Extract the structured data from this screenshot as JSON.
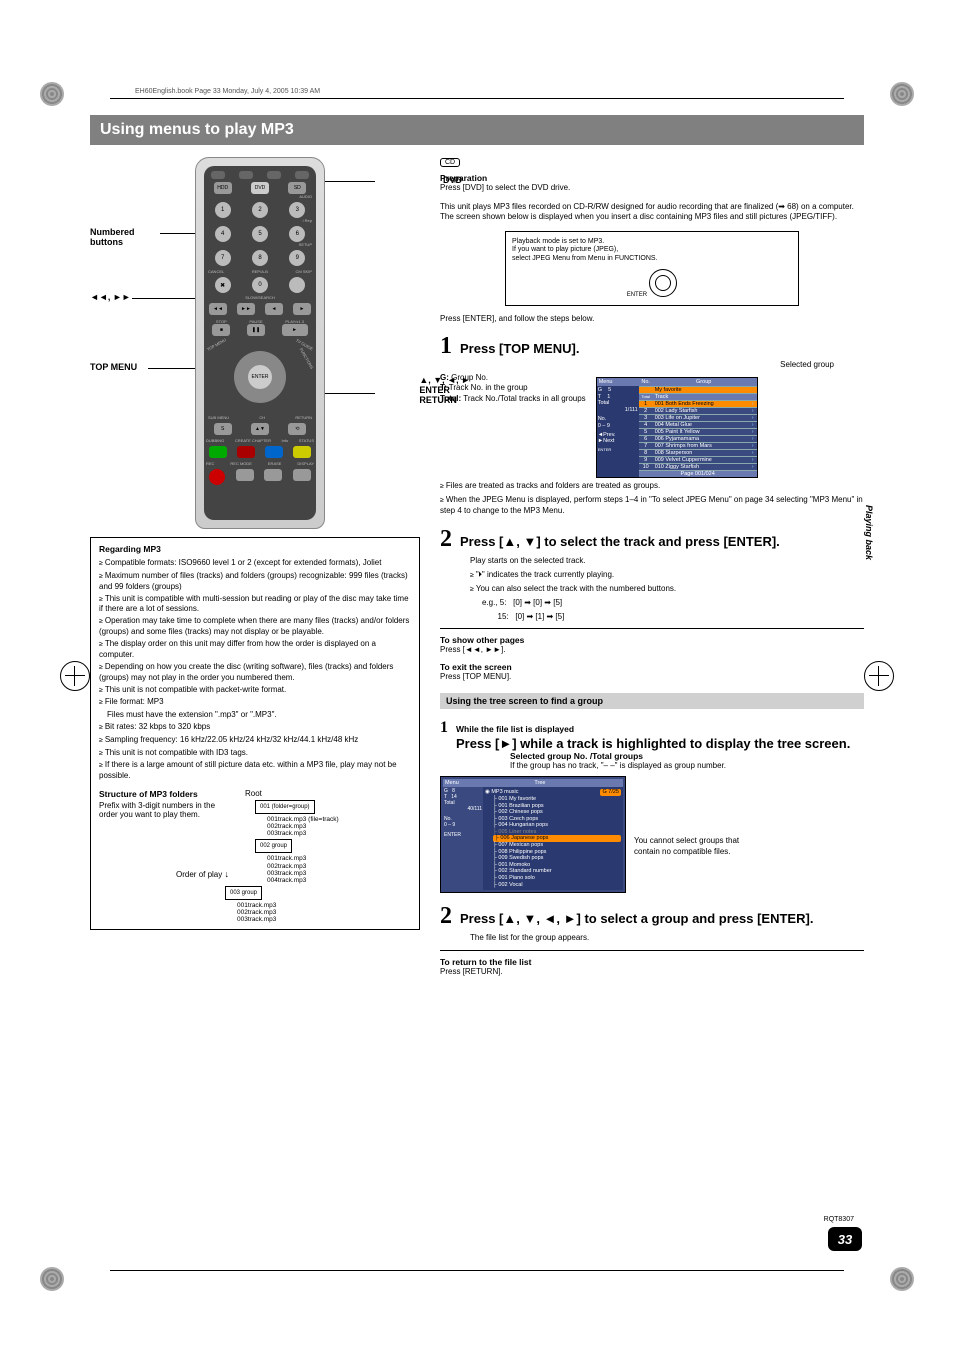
{
  "bookinfo": "EH60English.book  Page 33  Monday, July 4, 2005  10:39 AM",
  "title": "Using menus to play MP3",
  "remote_labels": {
    "numbered": "Numbered buttons",
    "skip": "◄◄, ►►",
    "topmenu": "TOP MENU",
    "dvd": "DVD",
    "arrows": "▲, ▼, ◄, ►\nENTER\nRETURN"
  },
  "remote_btns": {
    "hdd": "HDD",
    "dvd": "DVD",
    "sd": "SD",
    "audio": "AUDIO",
    "irep": "i Rep",
    "setup": "SETUP",
    "cancel": "CANCEL",
    "rep": "REP/A-B",
    "cmskip": "CM SKIP",
    "slow": "SLOW/SEARCH",
    "stop": "STOP",
    "pause": "PAUSE",
    "play": "PLAY/x1.3",
    "submenu": "SUB MENU",
    "return": "RETURN",
    "ch": "CH",
    "dubbing": "DUBBING",
    "create": "CREATE CHAPTER",
    "info": "Info",
    "status": "STATUS",
    "rec": "REC",
    "recmode": "REC MODE",
    "erase": "ERASE",
    "display": "DISPLAY",
    "s": "S",
    "enter": "ENTER",
    "tvguide": "TV GUIDE",
    "functions": "FUNCTIONS"
  },
  "mp3": {
    "h": "Regarding MP3",
    "p1": "Compatible formats: ISO9660 level 1 or 2 (except for extended formats), Joliet",
    "p2": "Maximum number of files (tracks) and folders (groups) recognizable: 999 files (tracks) and 99 folders (groups)",
    "p3": "This unit is compatible with multi-session but reading or play of the disc may take time if there are a lot of sessions.",
    "p4": "Operation may take time to complete when there are many files (tracks) and/or folders (groups) and some files (tracks) may not display or be playable.",
    "p5": "The display order on this unit may differ from how the order is displayed on a computer.",
    "p6": "Depending on how you create the disc (writing software), files (tracks) and folders (groups) may not play in the order you numbered them.",
    "p7": "This unit is not compatible with packet-write format.",
    "p8": "File format: MP3",
    "p8b": "Files must have the extension \".mp3\" or \".MP3\".",
    "p9": "Bit rates: 32 kbps to 320 kbps",
    "p10": "Sampling frequency: 16 kHz/22.05 kHz/24 kHz/32 kHz/44.1 kHz/48 kHz",
    "p11": "This unit is not compatible with ID3 tags.",
    "p12": "If there is a large amount of still picture data etc. within a MP3 file, play may not be possible.",
    "struct_h": "Structure of MP3 folders",
    "struct_p": "Prefix with 3-digit numbers in the order you want to play them.",
    "order": "Order of play",
    "root": "Root",
    "g1": "001 (folder=group)",
    "g1f": "001track.mp3 (file=track)\n002track.mp3\n003track.mp3",
    "g2": "002 group",
    "g2f": "001track.mp3\n002track.mp3\n003track.mp3\n004track.mp3",
    "g3": "003 group",
    "g3f": "001track.mp3\n002track.mp3\n003track.mp3"
  },
  "cd": "CD",
  "prep": {
    "h": "Preparation",
    "l1": "Press [DVD] to select the DVD drive.",
    "l2": "This unit plays MP3 files recorded on CD-R/RW designed for audio recording that are finalized (➡ 68) on a computer.",
    "l3": "The screen shown below is displayed when you insert a disc containing MP3 files and still pictures (JPEG/TIFF).",
    "pb1": "Playback mode is set to MP3.",
    "pb2": "If you want to play picture (JPEG),",
    "pb3": "select JPEG Menu from Menu in FUNCTIONS.",
    "enter": "ENTER",
    "l4": "Press [ENTER], and follow the steps below."
  },
  "step1": {
    "n": "1",
    "t": "Press [TOP MENU].",
    "selgrp": "Selected group",
    "g": "G:",
    "gv": "Group No.",
    "tk": "T:",
    "tkv": "Track No. in the group",
    "tot": "Total:",
    "totv": "Track No./Total tracks in all groups",
    "n1": "Files are treated as tracks and folders are treated as groups.",
    "n2": "When the JPEG Menu is displayed, perform steps 1–4 in \"To select JPEG Menu\" on page 34 selecting \"MP3 Menu\" in step 4 to change to the MP3 Menu."
  },
  "menu1": {
    "menu": "Menu",
    "no": "No.",
    "group": "Group",
    "g": "G",
    "t": "T",
    "total": "Total",
    "gv": "5",
    "tv": "1",
    "totv": "1/111",
    "nolbl": "No.",
    "digits": "0 – 9",
    "prev": "Prev.",
    "next": "Next",
    "enter": "ENTER",
    "totallbl": "Total",
    "tracklbl": "Track",
    "gname": "My favorite",
    "rows": [
      {
        "n": "1",
        "t": "001 Both Ends Freezing"
      },
      {
        "n": "2",
        "t": "002 Lady Starfish"
      },
      {
        "n": "3",
        "t": "003 Life on Jupiter"
      },
      {
        "n": "4",
        "t": "004 Metal Glue"
      },
      {
        "n": "5",
        "t": "005 Paint It Yellow"
      },
      {
        "n": "6",
        "t": "006 Pyjamamama"
      },
      {
        "n": "7",
        "t": "007 Shrimps from Mars"
      },
      {
        "n": "8",
        "t": "008 Starperson"
      },
      {
        "n": "9",
        "t": "009 Velvet Cuppermine"
      },
      {
        "n": "10",
        "t": "010 Ziggy Starfish"
      }
    ],
    "page": "Page 001/024"
  },
  "step2": {
    "n": "2",
    "t": "Press [▲, ▼] to select the track and press [ENTER].",
    "l1": "Play starts on the selected track.",
    "l2": "\"🞂\" indicates the track currently playing.",
    "l3": "You can also select the track with the numbered buttons.",
    "eg1": "e.g., 5:   [0] ➡ [0] ➡ [5]",
    "eg2": "       15:   [0] ➡ [1] ➡ [5]"
  },
  "other": {
    "h": "To show other pages",
    "l": "Press [◄◄, ►►]."
  },
  "exit": {
    "h": "To exit the screen",
    "l": "Press [TOP MENU]."
  },
  "treehdr": "Using the tree screen to find a group",
  "tstep1": {
    "n": "1",
    "pre": "While the file list is displayed",
    "t": "Press [►] while a track is highlighted to display the tree screen.",
    "sub": "Selected group No. /Total groups",
    "sub2": "If the group has no track, \"– –\" is displayed as group number."
  },
  "treewin": {
    "menu": "Menu",
    "tree": "Tree",
    "g": "G",
    "gv": "8",
    "t": "T",
    "tv": "14",
    "total": "Total",
    "totv": "40/111",
    "no": "No.",
    "d": "0 – 9",
    "enter": "ENTER",
    "gbadge": "G  7/25",
    "root": "MP3 music",
    "items": [
      "001 My favorite",
      "001 Brazilian pops",
      "002 Chinese pops",
      "003 Czech pops",
      "004 Hungarian pops",
      "005 Liner notes",
      "006 Japanese pops",
      "007 Mexican pops",
      "008 Philippine pops",
      "009 Swedish pops",
      "001 Momoko",
      "002 Standard number",
      "001 Piano solo",
      "002 Vocal"
    ],
    "note": "You cannot select groups that contain no compatible files."
  },
  "tstep2": {
    "n": "2",
    "t": "Press [▲, ▼, ◄, ►] to select a group and press [ENTER].",
    "l": "The file list for the group appears."
  },
  "ret": {
    "h": "To return to the file list",
    "l": "Press [RETURN]."
  },
  "sidetab": "Playing back",
  "pgnum": "33",
  "rqt": "RQT8307"
}
